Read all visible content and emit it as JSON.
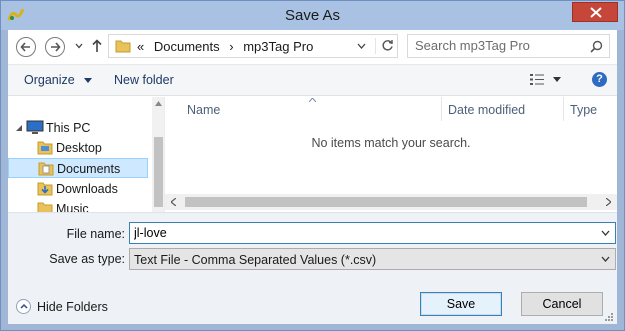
{
  "window": {
    "title": "Save As"
  },
  "address_bar": {
    "prefix": "«",
    "crumbs": [
      "Documents",
      "mp3Tag Pro"
    ]
  },
  "search": {
    "placeholder": "Search mp3Tag Pro"
  },
  "toolbar": {
    "organize_label": "Organize",
    "new_folder_label": "New folder"
  },
  "nav_pane": {
    "items": [
      {
        "label": "This PC",
        "icon": "computer-icon"
      },
      {
        "label": "Desktop",
        "icon": "folder-icon"
      },
      {
        "label": "Documents",
        "icon": "documents-folder-icon",
        "selected": true
      },
      {
        "label": "Downloads",
        "icon": "downloads-folder-icon"
      },
      {
        "label": "Music",
        "icon": "music-folder-icon"
      }
    ]
  },
  "file_list": {
    "columns": [
      "Name",
      "Date modified",
      "Type"
    ],
    "empty_message": "No items match your search."
  },
  "form": {
    "file_name_label": "File name:",
    "file_name_value": "jl-love",
    "save_as_type_label": "Save as type:",
    "save_as_type_value": "Text File - Comma Separated Values (*.csv)"
  },
  "footer": {
    "hide_folders_label": "Hide Folders",
    "save_label": "Save",
    "cancel_label": "Cancel"
  },
  "colors": {
    "title_bar": "#a9c2e3",
    "close_button": "#c7463a",
    "selection": "#cde8ff",
    "link_blue": "#1e3a66"
  }
}
